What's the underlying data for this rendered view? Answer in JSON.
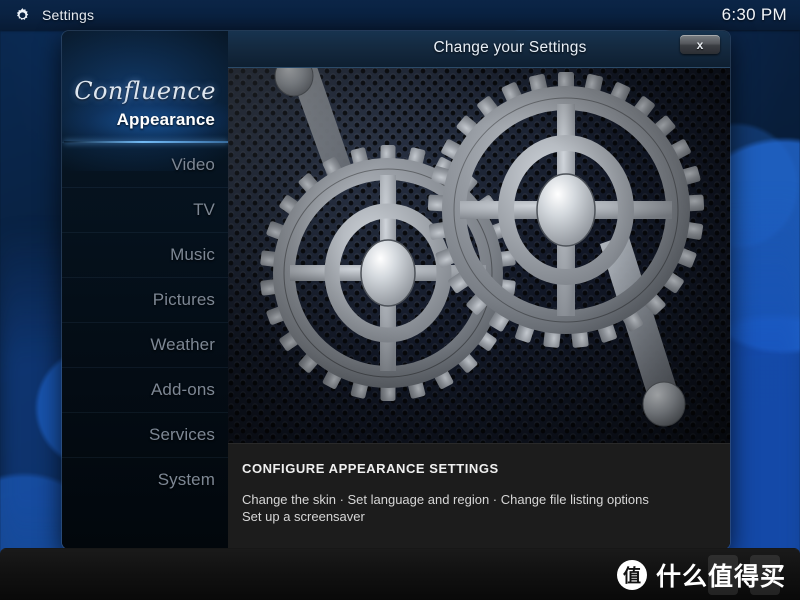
{
  "topbar": {
    "icon": "gear-icon",
    "title": "Settings",
    "clock": "6:30 PM"
  },
  "dialog": {
    "title": "Change your Settings",
    "close_label": "x",
    "brand": "Confluence"
  },
  "sidebar": {
    "items": [
      {
        "label": "Appearance",
        "selected": true
      },
      {
        "label": "Video",
        "selected": false
      },
      {
        "label": "TV",
        "selected": false
      },
      {
        "label": "Music",
        "selected": false
      },
      {
        "label": "Pictures",
        "selected": false
      },
      {
        "label": "Weather",
        "selected": false
      },
      {
        "label": "Add-ons",
        "selected": false
      },
      {
        "label": "Services",
        "selected": false
      },
      {
        "label": "System",
        "selected": false
      }
    ]
  },
  "content": {
    "artwork": "two-gears-illustration",
    "description_title": "CONFIGURE APPEARANCE SETTINGS",
    "description_line1": "Change the skin · Set language and region · Change file listing options",
    "description_line2": "Set up a screensaver"
  },
  "watermark": {
    "badge": "值",
    "text": "什么值得买"
  },
  "colors": {
    "accent_blue": "#6ab9ff",
    "dialog_bg": "#050a13",
    "desc_bg": "#1c1c1c",
    "selected_text": "#ffffff",
    "idle_text": "#7d8794"
  }
}
